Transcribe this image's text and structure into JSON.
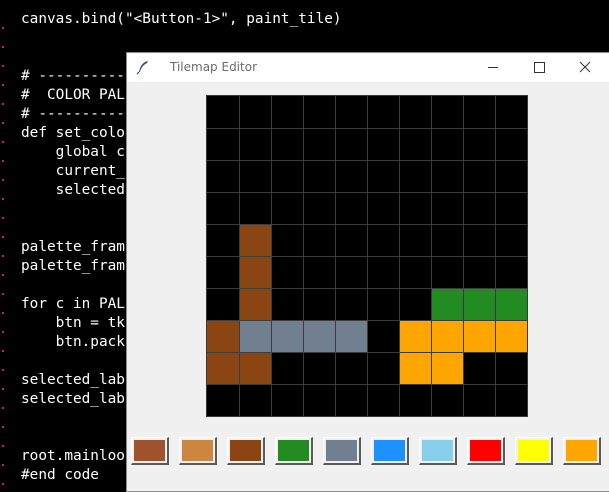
{
  "editor": {
    "lines": [
      {
        "text": "canvas.bind(\"<Button-1>\", paint_tile)",
        "row": 0
      },
      {
        "text": "# ----------",
        "row": 3
      },
      {
        "text": "#  COLOR PAL",
        "row": 4
      },
      {
        "text": "# ----------",
        "row": 5
      },
      {
        "text": "def set_colo",
        "row": 6
      },
      {
        "text": "    global c",
        "row": 7
      },
      {
        "text": "    current_",
        "row": 8
      },
      {
        "text": "    selected",
        "row": 9
      },
      {
        "text": "palette_fram",
        "row": 12
      },
      {
        "text": "palette_fram",
        "row": 13
      },
      {
        "text": "for c in PAL",
        "row": 15
      },
      {
        "text": "    btn = tk",
        "row": 16
      },
      {
        "text": "    btn.pack",
        "row": 17
      },
      {
        "text": "selected_lab",
        "row": 19
      },
      {
        "text": "selected_lab",
        "row": 20
      },
      {
        "text": "root.mainloo",
        "row": 23
      },
      {
        "text": "#end code",
        "row": 24
      }
    ]
  },
  "window": {
    "title": "Tilemap Editor",
    "icon": "feather-icon",
    "controls": [
      "minimize-icon",
      "maximize-icon",
      "close-icon"
    ]
  },
  "grid": {
    "cols": 10,
    "rows": 10,
    "background": "#000000",
    "tiles": [
      {
        "col": 1,
        "row": 4,
        "color": "#8B4513"
      },
      {
        "col": 1,
        "row": 5,
        "color": "#8B4513"
      },
      {
        "col": 1,
        "row": 6,
        "color": "#8B4513"
      },
      {
        "col": 7,
        "row": 6,
        "color": "#228B22"
      },
      {
        "col": 8,
        "row": 6,
        "color": "#228B22"
      },
      {
        "col": 9,
        "row": 6,
        "color": "#228B22"
      },
      {
        "col": 0,
        "row": 7,
        "color": "#8B4513"
      },
      {
        "col": 1,
        "row": 7,
        "color": "#708090"
      },
      {
        "col": 2,
        "row": 7,
        "color": "#708090"
      },
      {
        "col": 3,
        "row": 7,
        "color": "#708090"
      },
      {
        "col": 4,
        "row": 7,
        "color": "#708090"
      },
      {
        "col": 6,
        "row": 7,
        "color": "#FFA500"
      },
      {
        "col": 7,
        "row": 7,
        "color": "#FFA500"
      },
      {
        "col": 8,
        "row": 7,
        "color": "#FFA500"
      },
      {
        "col": 9,
        "row": 7,
        "color": "#FFA500"
      },
      {
        "col": 0,
        "row": 8,
        "color": "#8B4513"
      },
      {
        "col": 1,
        "row": 8,
        "color": "#8B4513"
      },
      {
        "col": 6,
        "row": 8,
        "color": "#FFA500"
      },
      {
        "col": 7,
        "row": 8,
        "color": "#FFA500"
      }
    ]
  },
  "palette": {
    "colors": [
      "#A0522D",
      "#CD853F",
      "#8B4513",
      "#228B22",
      "#708090",
      "#1E90FF",
      "#87CEEB",
      "#FF0000",
      "#FFFF00",
      "#FFA500"
    ]
  }
}
